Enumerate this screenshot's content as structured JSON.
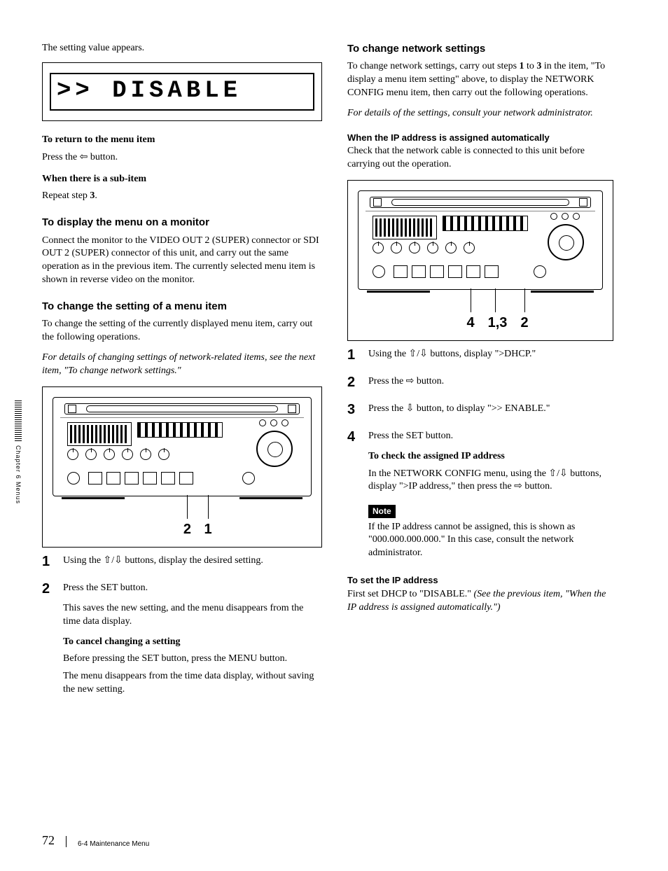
{
  "sideTab": "Chapter 6  Menus",
  "footer": {
    "page": "72",
    "section": "6-4 Maintenance Menu"
  },
  "left": {
    "intro": "The setting value appears.",
    "lcd": ">> DISABLE",
    "returnTitle": "To return to the menu item",
    "returnBody": "Press the ⇦ button.",
    "subItemTitle": "When there is a sub-item",
    "subItemBody_pre": "Repeat step ",
    "subItemBody_bold": "3",
    "subItemBody_post": ".",
    "displayHeading": "To display the menu on a monitor",
    "displayBody": "Connect the monitor to the VIDEO OUT 2 (SUPER) connector or SDI OUT 2 (SUPER) connector of this unit, and carry out the same operation as in the previous item. The currently selected menu item is shown in reverse video on the monitor.",
    "changeHeading": "To change the setting of a menu item",
    "changeIntro": "To change the setting of the currently displayed menu item, carry out the following operations.",
    "changeNote": "For details of changing settings of network-related items, see the next item, \"To change network settings.\"",
    "device1_callouts": {
      "a": "2",
      "b": "1"
    },
    "steps": [
      {
        "num": "1",
        "body": "Using the ⇧/⇩ buttons, display the desired setting."
      },
      {
        "num": "2",
        "body": "Press the SET button.",
        "after1": "This saves the new setting, and the menu disappears from the time data display.",
        "cancelTitle": "To cancel changing a setting",
        "cancel1": "Before pressing the SET button, press the MENU button.",
        "cancel2": "The menu disappears from the time data display, without saving the new setting."
      }
    ]
  },
  "right": {
    "netHeading": "To change network settings",
    "netIntro_pre": "To change network settings, carry out steps ",
    "netIntro_b1": "1",
    "netIntro_mid": " to ",
    "netIntro_b3": "3",
    "netIntro_post": " in the item, \"To display a menu item setting\" above, to display the NETWORK CONFIG menu item, then carry out the following operations.",
    "netAdmin": "For details of the settings, consult your network administrator.",
    "autoHeading": "When the IP address is assigned automatically",
    "autoIntro": "Check that the network cable is connected to this unit before carrying out the operation.",
    "device2_callouts": {
      "a": "4",
      "b": "1,3",
      "c": "2"
    },
    "steps": [
      {
        "num": "1",
        "body": "Using the ⇧/⇩ buttons, display \">DHCP.\""
      },
      {
        "num": "2",
        "body": "Press the ⇨ button."
      },
      {
        "num": "3",
        "body": "Press the ⇩ button, to display \">> ENABLE.\""
      },
      {
        "num": "4",
        "body": "Press the SET button.",
        "checkTitle": "To check the assigned IP address",
        "check1": "In the NETWORK CONFIG menu, using the ⇧/⇩ buttons, display \">IP address,\" then press the ⇨ button.",
        "noteLabel": "Note",
        "noteBody": "If the IP address cannot be assigned, this is shown as \"000.000.000.000.\" In this case, consult the network administrator."
      }
    ],
    "setIpHeading": "To set the IP address",
    "setIp_pre": "First set DHCP to \"DISABLE.\" ",
    "setIp_ital": "(See the previous item, \"When the IP address is assigned automatically.\")"
  }
}
